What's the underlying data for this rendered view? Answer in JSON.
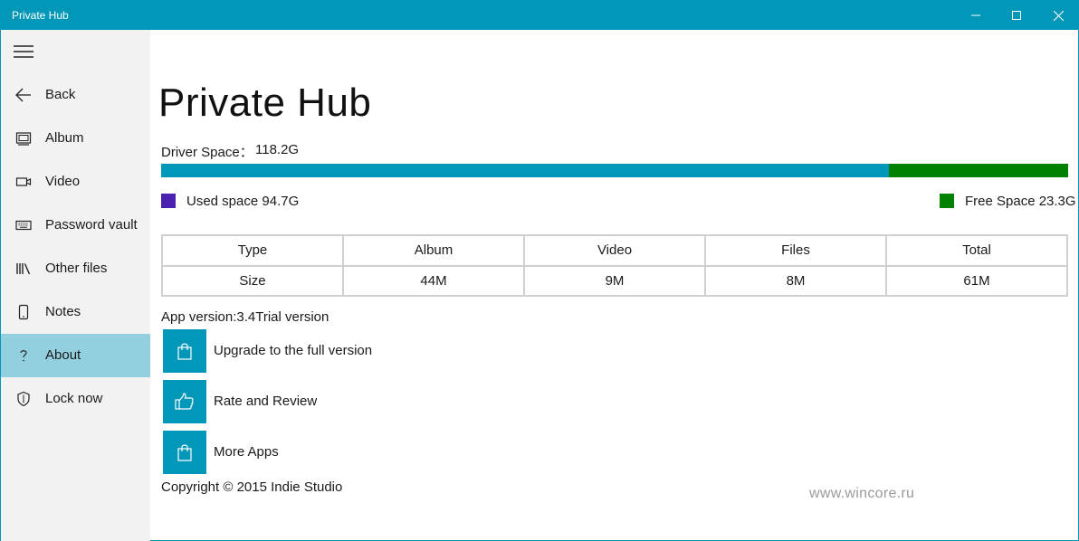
{
  "window": {
    "title": "Private Hub"
  },
  "sidebar": {
    "items": [
      {
        "label": "Back",
        "icon": "back-arrow-icon"
      },
      {
        "label": "Album",
        "icon": "album-icon"
      },
      {
        "label": "Video",
        "icon": "video-camera-icon"
      },
      {
        "label": "Password vault",
        "icon": "keyboard-icon"
      },
      {
        "label": "Other files",
        "icon": "library-icon"
      },
      {
        "label": "Notes",
        "icon": "phone-icon"
      },
      {
        "label": "About",
        "icon": "question-icon",
        "active": true
      },
      {
        "label": "Lock now",
        "icon": "shield-icon"
      }
    ]
  },
  "main": {
    "title": "Private Hub",
    "drive_label": "Driver Space：",
    "drive_value": "118.2G",
    "used_fraction": 0.802,
    "used_label": "Used space 94.7G",
    "free_label": "Free Space 23.3G",
    "colors": {
      "accent": "#0097b8",
      "used_swatch": "#4b1fb0",
      "free": "#008000",
      "active_nav": "#93d0df"
    },
    "table": {
      "headers": [
        "Type",
        "Album",
        "Video",
        "Files",
        "Total"
      ],
      "row": [
        "Size",
        "44M",
        "9M",
        "8M",
        "61M"
      ]
    },
    "version": "App version:3.4Trial version",
    "actions": [
      {
        "label": "Upgrade to the full version",
        "icon": "shopping-bag-icon"
      },
      {
        "label": "Rate and Review",
        "icon": "thumbs-up-icon"
      },
      {
        "label": "More Apps",
        "icon": "shopping-bag-icon"
      }
    ],
    "copyright": "Copyright ©  2015  Indie Studio"
  },
  "watermark": "www.wincore.ru"
}
